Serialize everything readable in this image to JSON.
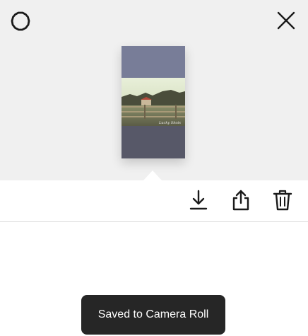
{
  "header": {
    "settings_icon": "gear-icon",
    "close_icon": "close-icon"
  },
  "preview": {
    "thumbnail": "saved-photo-thumbnail",
    "watermark": "Lucky Shots"
  },
  "toolbar": {
    "download_icon": "download-icon",
    "share_icon": "share-icon",
    "delete_icon": "trash-icon"
  },
  "toast": {
    "message": "Saved to Camera Roll"
  },
  "colors": {
    "preview_background": "#f0f0f0",
    "toast_background": "#262626",
    "icon": "#1a1a1a"
  }
}
